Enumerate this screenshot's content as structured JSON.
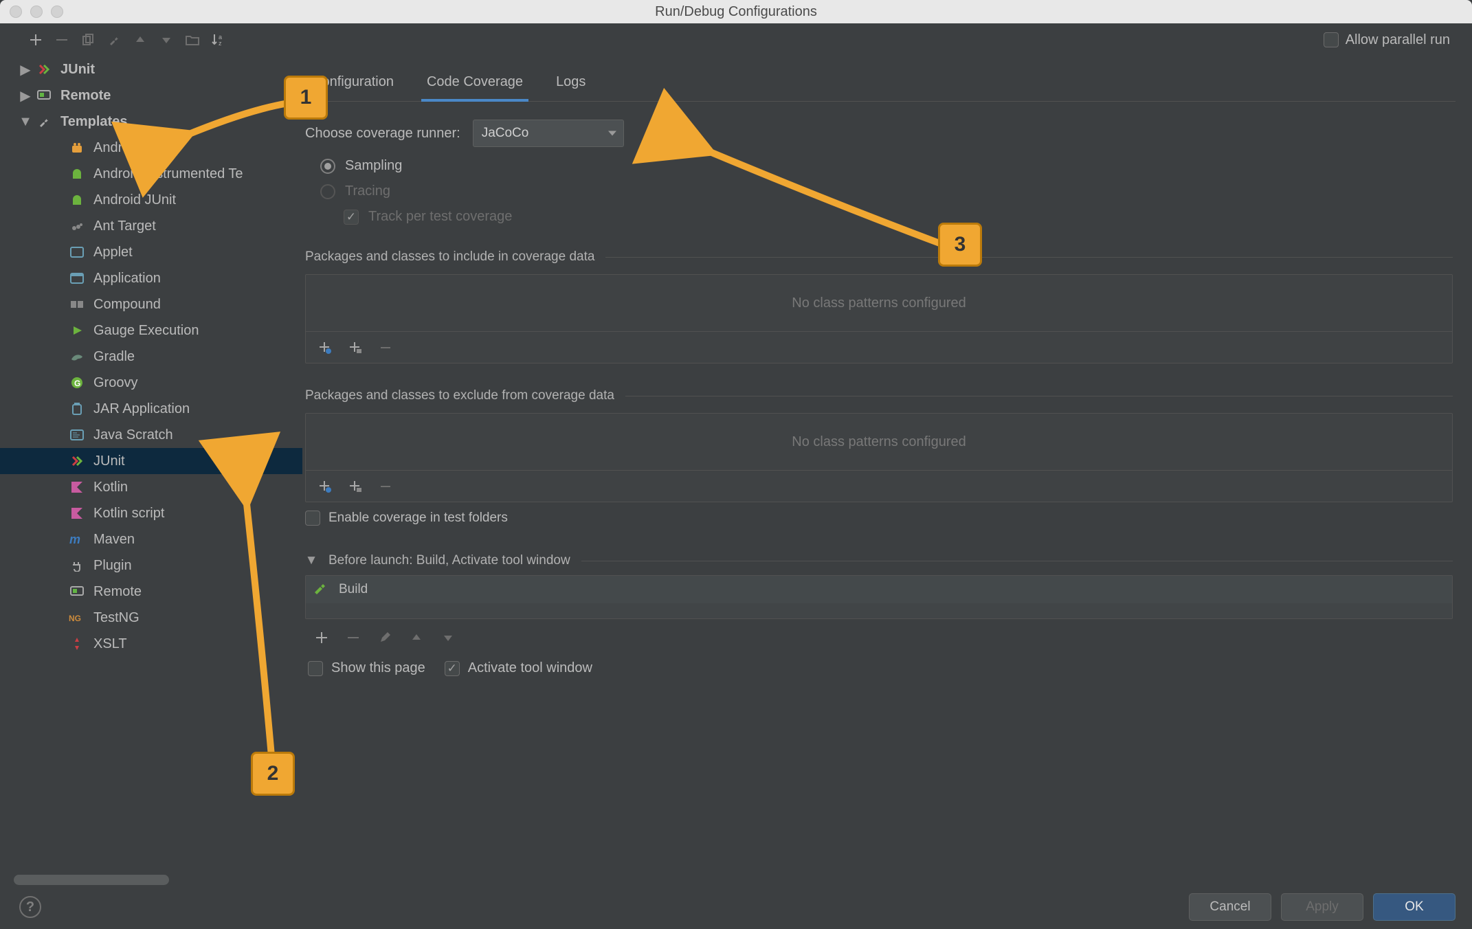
{
  "window": {
    "title": "Run/Debug Configurations"
  },
  "allow_parallel": {
    "label": "Allow parallel run"
  },
  "tree": {
    "junit_root": "JUnit",
    "remote_root": "Remote",
    "templates_root": "Templates",
    "items": [
      {
        "label": "Android App"
      },
      {
        "label": "Android Instrumented Te"
      },
      {
        "label": "Android JUnit"
      },
      {
        "label": "Ant Target"
      },
      {
        "label": "Applet"
      },
      {
        "label": "Application"
      },
      {
        "label": "Compound"
      },
      {
        "label": "Gauge Execution"
      },
      {
        "label": "Gradle"
      },
      {
        "label": "Groovy"
      },
      {
        "label": "JAR Application"
      },
      {
        "label": "Java Scratch"
      },
      {
        "label": "JUnit"
      },
      {
        "label": "Kotlin"
      },
      {
        "label": "Kotlin script"
      },
      {
        "label": "Maven"
      },
      {
        "label": "Plugin"
      },
      {
        "label": "Remote"
      },
      {
        "label": "TestNG"
      },
      {
        "label": "XSLT"
      }
    ]
  },
  "tabs": {
    "configuration": "Configuration",
    "code_coverage": "Code Coverage",
    "logs": "Logs"
  },
  "coverage": {
    "runner_label": "Choose coverage runner:",
    "runner_value": "JaCoCo",
    "sampling": "Sampling",
    "tracing": "Tracing",
    "track_per_test": "Track per test coverage",
    "include_header": "Packages and classes to include in coverage data",
    "exclude_header": "Packages and classes to exclude from coverage data",
    "empty_msg": "No class patterns configured",
    "enable_test_folders": "Enable coverage in test folders"
  },
  "before_launch": {
    "header": "Before launch: Build, Activate tool window",
    "build": "Build"
  },
  "footer": {
    "show_page": "Show this page",
    "activate_window": "Activate tool window"
  },
  "buttons": {
    "cancel": "Cancel",
    "apply": "Apply",
    "ok": "OK"
  },
  "callouts": {
    "c1": "1",
    "c2": "2",
    "c3": "3"
  },
  "colors": {
    "accent": "#4a88c7",
    "callout": "#f0a732",
    "selection": "#0d293e"
  }
}
